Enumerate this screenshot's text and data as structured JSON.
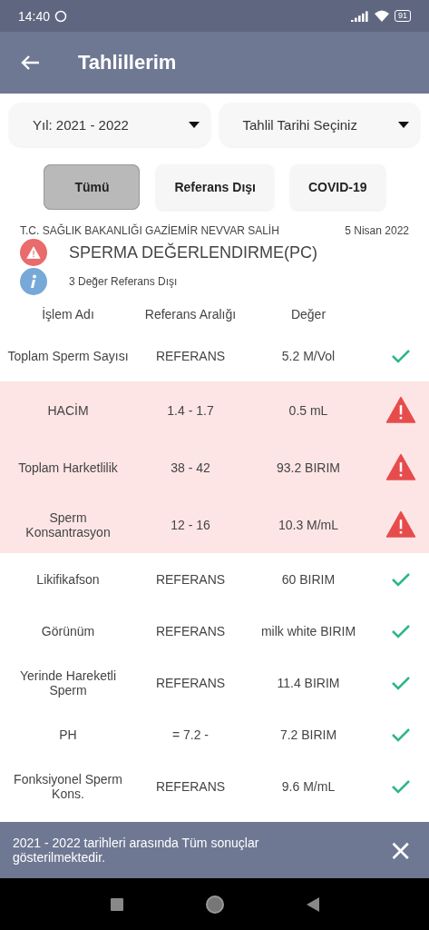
{
  "status_bar": {
    "time": "14:40",
    "battery": "91"
  },
  "app_bar": {
    "title": "Tahlillerim"
  },
  "dropdowns": [
    {
      "value": "Yıl: 2021 - 2022"
    },
    {
      "value": "Tahlil Tarihi Seçiniz"
    }
  ],
  "filters": [
    {
      "label": "Tümü",
      "selected": true
    },
    {
      "label": "Referans Dışı",
      "selected": false
    },
    {
      "label": "COVID-19",
      "selected": false
    }
  ],
  "report": {
    "institution": "T.C. SAĞLIK BAKANLIĞI GAZİEMİR NEVVAR SALİH",
    "date": "5 Nisan 2022",
    "test_name": "SPERMA DEĞERLENDIRME(PC)",
    "summary": "3 Değer Referans Dışı"
  },
  "table": {
    "columns": [
      "İşlem Adı",
      "Referans Aralığı",
      "Değer"
    ],
    "rows": [
      {
        "name": "Toplam Sperm Sayısı",
        "reference": "REFERANS",
        "value": "5.2 M/Vol",
        "out_of_range": false
      },
      {
        "name": "HACİM",
        "reference": "1.4 - 1.7",
        "value": "0.5 mL",
        "out_of_range": true
      },
      {
        "name": "Toplam Harketlilik",
        "reference": "38 - 42",
        "value": "93.2 BIRIM",
        "out_of_range": true
      },
      {
        "name": "Sperm Konsantrasyon",
        "reference": "12 - 16",
        "value": "10.3 M/mL",
        "out_of_range": true
      },
      {
        "name": "Likifikafson",
        "reference": "REFERANS",
        "value": "60 BIRIM",
        "out_of_range": false
      },
      {
        "name": "Görünüm",
        "reference": "REFERANS",
        "value": "milk white BIRIM",
        "out_of_range": false
      },
      {
        "name": "Yerinde Hareketli Sperm",
        "reference": "REFERANS",
        "value": "11.4 BIRIM",
        "out_of_range": false
      },
      {
        "name": "PH",
        "reference": "= 7.2 -",
        "value": "7.2 BIRIM",
        "out_of_range": false
      },
      {
        "name": "Fonksiyonel Sperm Kons.",
        "reference": "REFERANS",
        "value": "9.6 M/mL",
        "out_of_range": false
      }
    ]
  },
  "snackbar": {
    "message": "2021 - 2022 tarihleri arasında Tüm sonuçlar gösterilmektedir.",
    "close": "×"
  }
}
